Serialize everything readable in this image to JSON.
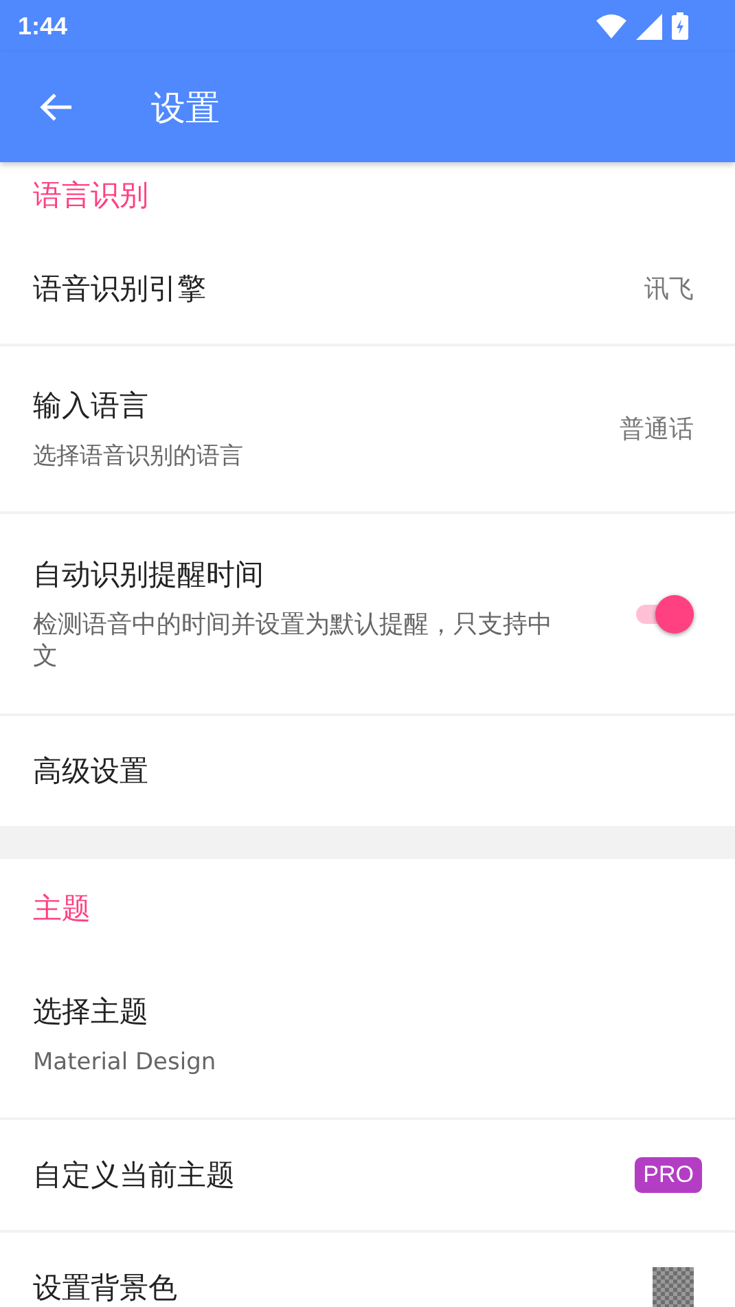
{
  "status_bar": {
    "time": "1:44"
  },
  "app_bar": {
    "title": "设置"
  },
  "sections": [
    {
      "header": "语言识别",
      "items": [
        {
          "kind": "value",
          "title": "语音识别引擎",
          "value": "讯飞"
        },
        {
          "kind": "value",
          "title": "输入语言",
          "summary": "选择语音识别的语言",
          "value": "普通话"
        },
        {
          "kind": "switch",
          "title": "自动识别提醒时间",
          "summary": "检测语音中的时间并设置为默认提醒，只支持中文",
          "on": true
        },
        {
          "kind": "plain",
          "title": "高级设置"
        }
      ]
    },
    {
      "header": "主题",
      "items": [
        {
          "kind": "plain",
          "title": "选择主题",
          "summary": "Material Design"
        },
        {
          "kind": "badge",
          "title": "自定义当前主题",
          "badge": "PRO"
        },
        {
          "kind": "swatch",
          "title": "设置背景色"
        }
      ]
    }
  ]
}
